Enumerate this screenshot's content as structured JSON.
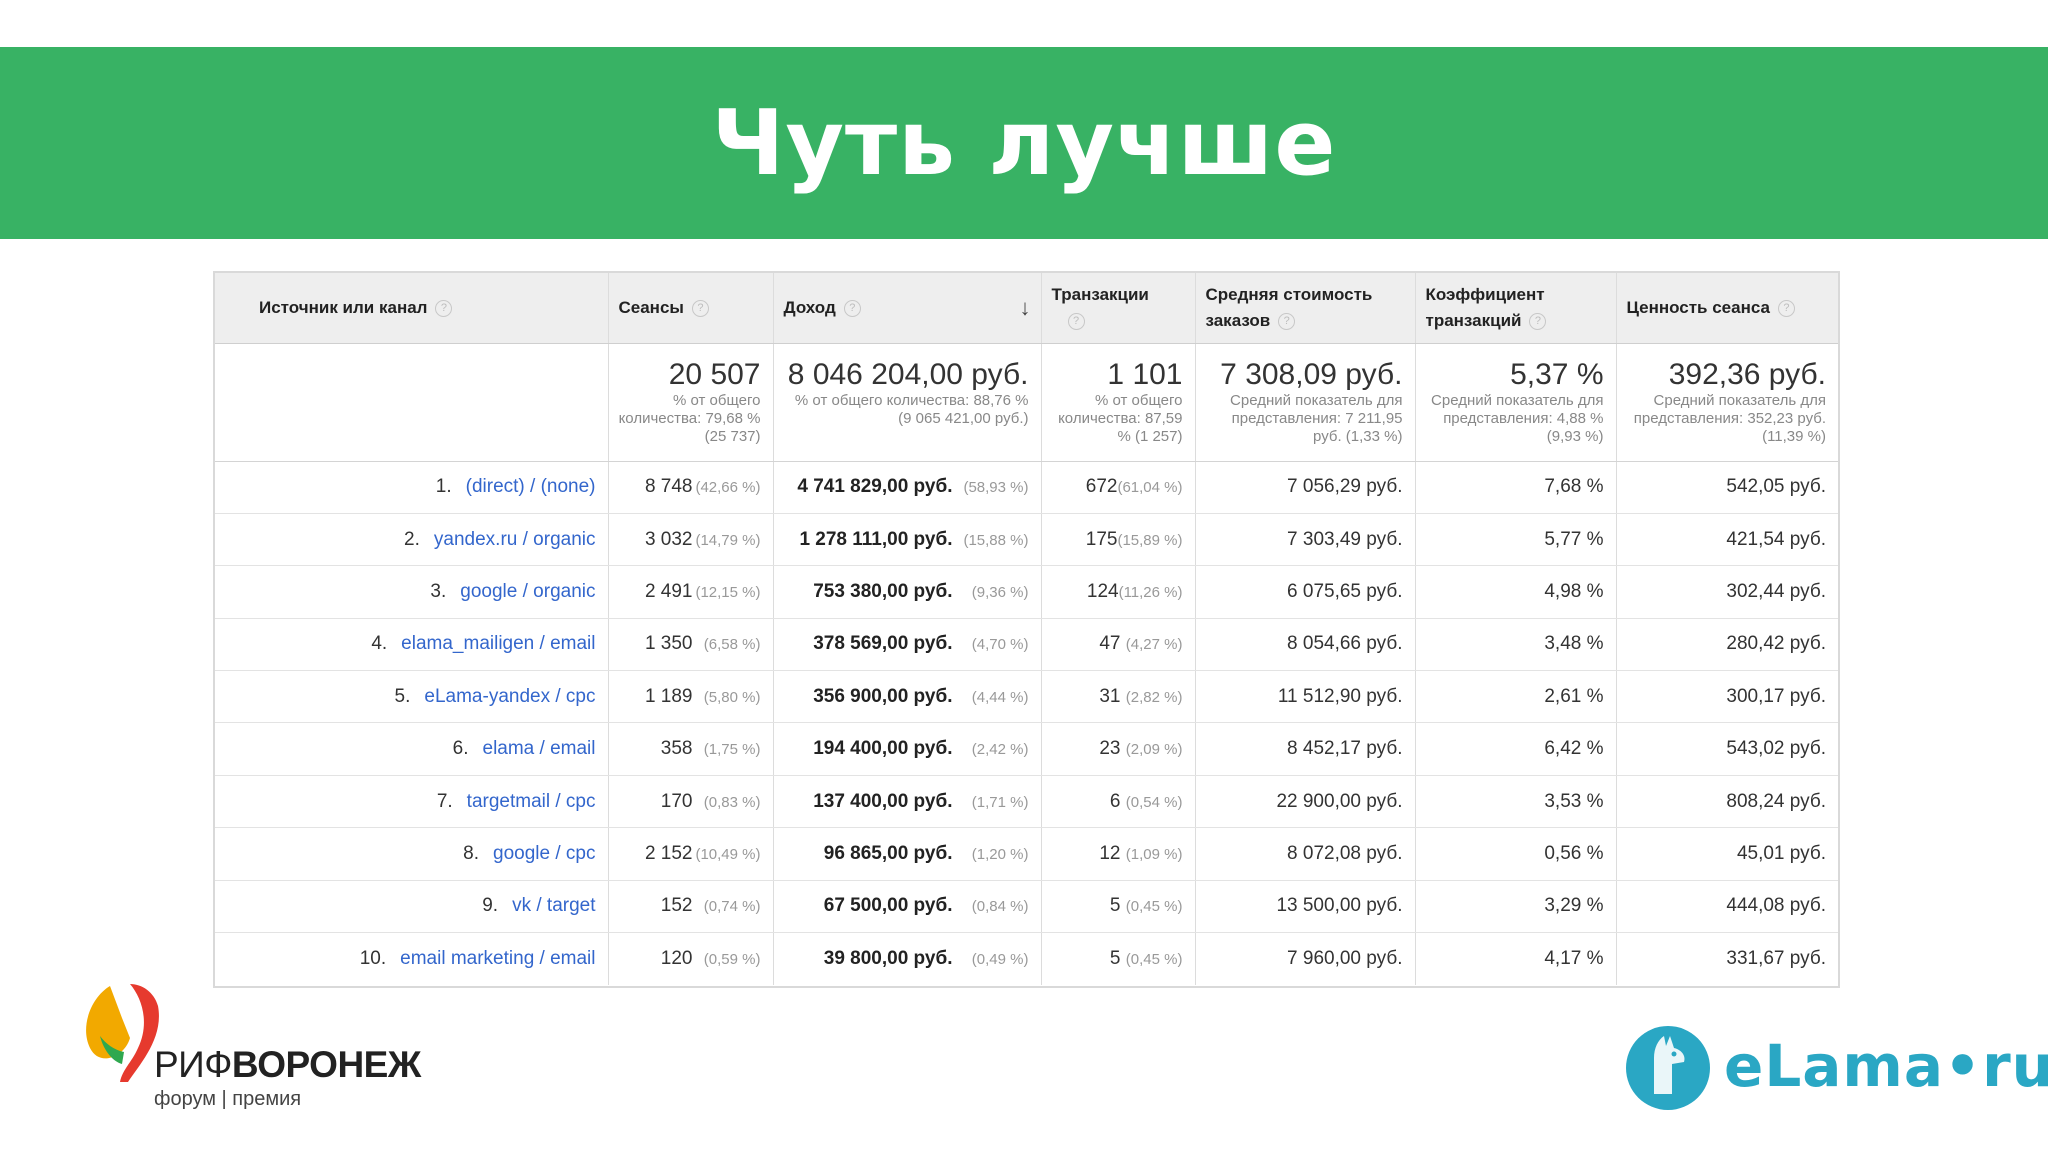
{
  "slide": {
    "title": "Чуть лучше"
  },
  "table": {
    "headers": {
      "source": "Источник или канал",
      "sessions": "Сеансы",
      "revenue": "Доход",
      "transactions": "Транзакции",
      "avg_order": "Средняя стоимость заказов",
      "conversion": "Коэффициент транзакций",
      "session_value": "Ценность сеанса",
      "help": "?",
      "sort": "↓"
    },
    "totals": {
      "sessions": {
        "value": "20 507",
        "sub": "% от общего количества: 79,68 % (25 737)"
      },
      "revenue": {
        "value": "8 046 204,00 руб.",
        "sub": "% от общего количества: 88,76 % (9 065 421,00 руб.)"
      },
      "transactions": {
        "value": "1 101",
        "sub": "% от общего количества: 87,59 % (1 257)"
      },
      "avg_order": {
        "value": "7 308,09 руб.",
        "sub": "Средний показатель для представления: 7 211,95 руб. (1,33 %)"
      },
      "conversion": {
        "value": "5,37 %",
        "sub": "Средний показатель для представления: 4,88 % (9,93 %)"
      },
      "session_value": {
        "value": "392,36 руб.",
        "sub": "Средний показатель для представления: 352,23 руб. (11,39 %)"
      }
    },
    "rows": [
      {
        "n": "1.",
        "source": "(direct) / (none)",
        "sessions": "8 748",
        "sessions_pct": "(42,66 %)",
        "revenue": "4 741 829,00 руб.",
        "revenue_pct": "(58,93 %)",
        "tx": "672",
        "tx_pct": "(61,04 %)",
        "avg": "7 056,29 руб.",
        "conv": "7,68 %",
        "value": "542,05 руб."
      },
      {
        "n": "2.",
        "source": "yandex.ru / organic",
        "sessions": "3 032",
        "sessions_pct": "(14,79 %)",
        "revenue": "1 278 111,00 руб.",
        "revenue_pct": "(15,88 %)",
        "tx": "175",
        "tx_pct": "(15,89 %)",
        "avg": "7 303,49 руб.",
        "conv": "5,77 %",
        "value": "421,54 руб."
      },
      {
        "n": "3.",
        "source": "google / organic",
        "sessions": "2 491",
        "sessions_pct": "(12,15 %)",
        "revenue": "753 380,00 руб.",
        "revenue_pct": "(9,36 %)",
        "tx": "124",
        "tx_pct": "(11,26 %)",
        "avg": "6 075,65 руб.",
        "conv": "4,98 %",
        "value": "302,44 руб."
      },
      {
        "n": "4.",
        "source": "elama_mailigen / email",
        "sessions": "1 350",
        "sessions_pct": "(6,58 %)",
        "revenue": "378 569,00 руб.",
        "revenue_pct": "(4,70 %)",
        "tx": "47",
        "tx_pct": "(4,27 %)",
        "avg": "8 054,66 руб.",
        "conv": "3,48 %",
        "value": "280,42 руб."
      },
      {
        "n": "5.",
        "source": "eLama-yandex / cpc",
        "sessions": "1 189",
        "sessions_pct": "(5,80 %)",
        "revenue": "356 900,00 руб.",
        "revenue_pct": "(4,44 %)",
        "tx": "31",
        "tx_pct": "(2,82 %)",
        "avg": "11 512,90 руб.",
        "conv": "2,61 %",
        "value": "300,17 руб."
      },
      {
        "n": "6.",
        "source": "elama / email",
        "sessions": "358",
        "sessions_pct": "(1,75 %)",
        "revenue": "194 400,00 руб.",
        "revenue_pct": "(2,42 %)",
        "tx": "23",
        "tx_pct": "(2,09 %)",
        "avg": "8 452,17 руб.",
        "conv": "6,42 %",
        "value": "543,02 руб."
      },
      {
        "n": "7.",
        "source": "targetmail / cpc",
        "sessions": "170",
        "sessions_pct": "(0,83 %)",
        "revenue": "137 400,00 руб.",
        "revenue_pct": "(1,71 %)",
        "tx": "6",
        "tx_pct": "(0,54 %)",
        "avg": "22 900,00 руб.",
        "conv": "3,53 %",
        "value": "808,24 руб."
      },
      {
        "n": "8.",
        "source": "google / cpc",
        "sessions": "2 152",
        "sessions_pct": "(10,49 %)",
        "revenue": "96 865,00 руб.",
        "revenue_pct": "(1,20 %)",
        "tx": "12",
        "tx_pct": "(1,09 %)",
        "avg": "8 072,08 руб.",
        "conv": "0,56 %",
        "value": "45,01 руб."
      },
      {
        "n": "9.",
        "source": "vk / target",
        "sessions": "152",
        "sessions_pct": "(0,74 %)",
        "revenue": "67 500,00 руб.",
        "revenue_pct": "(0,84 %)",
        "tx": "5",
        "tx_pct": "(0,45 %)",
        "avg": "13 500,00 руб.",
        "conv": "3,29 %",
        "value": "444,08 руб."
      },
      {
        "n": "10.",
        "source": "email marketing / email",
        "sessions": "120",
        "sessions_pct": "(0,59 %)",
        "revenue": "39 800,00 руб.",
        "revenue_pct": "(0,49 %)",
        "tx": "5",
        "tx_pct": "(0,45 %)",
        "avg": "7 960,00 руб.",
        "conv": "4,17 %",
        "value": "331,67 руб."
      }
    ]
  },
  "logos": {
    "rif": {
      "name_light": "РИФ",
      "name_bold": "ВОРОНЕЖ",
      "subtitle": "форум | премия",
      "colors": [
        "#e63a2e",
        "#f2a900",
        "#2fa84f"
      ]
    },
    "elama": {
      "text": "eLama•ru",
      "color": "#2aa7c4"
    }
  }
}
